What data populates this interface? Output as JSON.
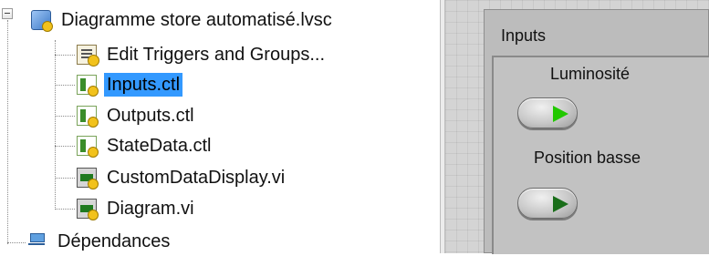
{
  "project_tree": {
    "root": {
      "label": "Diagramme store automatisé.lvsc",
      "icon": "statechart-project-icon"
    },
    "items": [
      {
        "label": "Edit Triggers and Groups...",
        "icon": "triggers-icon",
        "selected": false
      },
      {
        "label": "Inputs.ctl",
        "icon": "control-file-icon",
        "selected": true
      },
      {
        "label": "Outputs.ctl",
        "icon": "control-file-icon",
        "selected": false
      },
      {
        "label": "StateData.ctl",
        "icon": "control-file-icon",
        "selected": false
      },
      {
        "label": "CustomDataDisplay.vi",
        "icon": "vi-file-icon",
        "selected": false
      },
      {
        "label": "Diagram.vi",
        "icon": "vi-file-icon",
        "selected": false
      }
    ],
    "dependencies": {
      "label": "Dépendances",
      "icon": "dependencies-icon"
    }
  },
  "front_panel": {
    "cluster_title": "Inputs",
    "controls": [
      {
        "label": "Luminosité",
        "type": "boolean-led-button",
        "state": "on"
      },
      {
        "label": "Position basse",
        "type": "boolean-led-button",
        "state": "off"
      }
    ]
  },
  "colors": {
    "selection": "#3399ff",
    "panel_bg": "#d4d4d4",
    "led_on": "#22c800",
    "led_off": "#1a6e1a"
  }
}
